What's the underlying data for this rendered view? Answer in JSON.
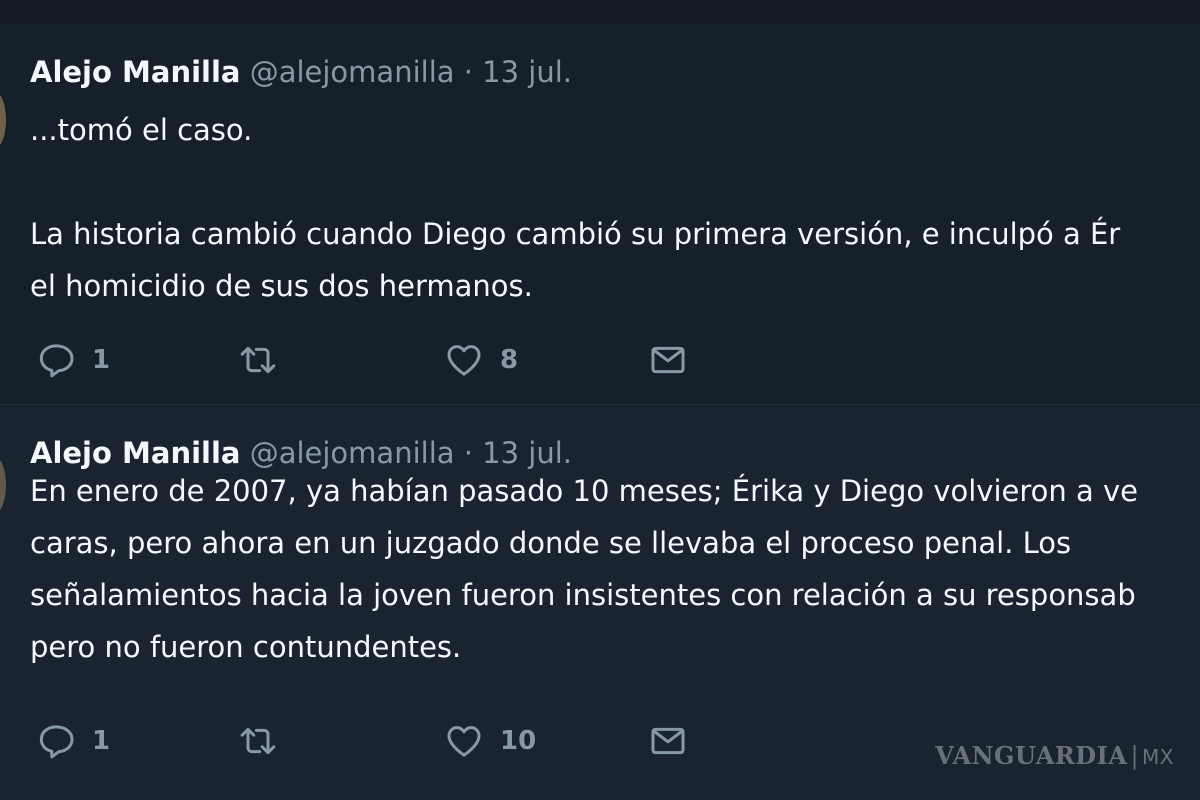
{
  "tweets": [
    {
      "author_name": "Alejo Manilla",
      "author_handle": "@alejomanilla",
      "separator": "·",
      "date": "13 jul.",
      "paragraphs": [
        [
          "...tomó el caso."
        ],
        [
          "La historia cambió cuando Diego cambió su primera versión, e inculpó a Ér",
          "el homicidio de sus dos hermanos."
        ]
      ],
      "replies": "1",
      "retweets": "",
      "likes": "8"
    },
    {
      "author_name": "Alejo Manilla",
      "author_handle": "@alejomanilla",
      "separator": "·",
      "date": "13 jul.",
      "paragraphs": [
        [
          "En enero de 2007, ya habían pasado 10 meses; Érika y Diego volvieron a ve",
          "caras, pero ahora en un juzgado donde se llevaba el proceso penal. Los",
          "señalamientos hacia la joven fueron insistentes con relación a su responsab",
          "pero no fueron contundentes."
        ]
      ],
      "replies": "1",
      "retweets": "",
      "likes": "10"
    }
  ],
  "watermark": {
    "brand": "VANGUARDIA",
    "separator": "|",
    "suffix": "MX"
  },
  "icons": {
    "reply": "reply-icon",
    "retweet": "retweet-icon",
    "like": "heart-icon",
    "message": "envelope-icon"
  },
  "colors": {
    "background": "#15202b",
    "text_primary": "#f5f8fa",
    "text_secondary": "#8899a6"
  }
}
